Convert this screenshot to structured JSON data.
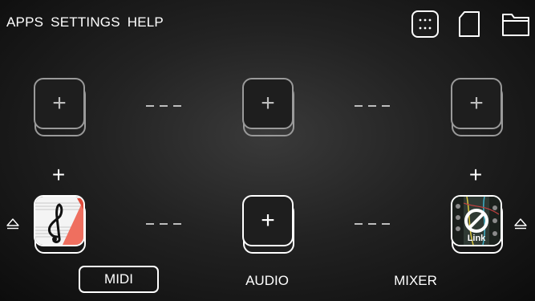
{
  "menu": {
    "apps": "APPS",
    "settings": "SETTINGS",
    "help": "HELP"
  },
  "toolbar": {
    "icons": [
      "grid-icon",
      "new-file-icon",
      "folder-icon"
    ]
  },
  "slots": {
    "row1": [
      "+",
      "+",
      "+"
    ],
    "row2": [
      "app-notation",
      "+",
      "app-link"
    ],
    "connector": "+",
    "app_link_text": "Link"
  },
  "tabs": {
    "midi": "MIDI",
    "audio": "AUDIO",
    "mixer": "MIXER",
    "selected": "MIDI"
  }
}
